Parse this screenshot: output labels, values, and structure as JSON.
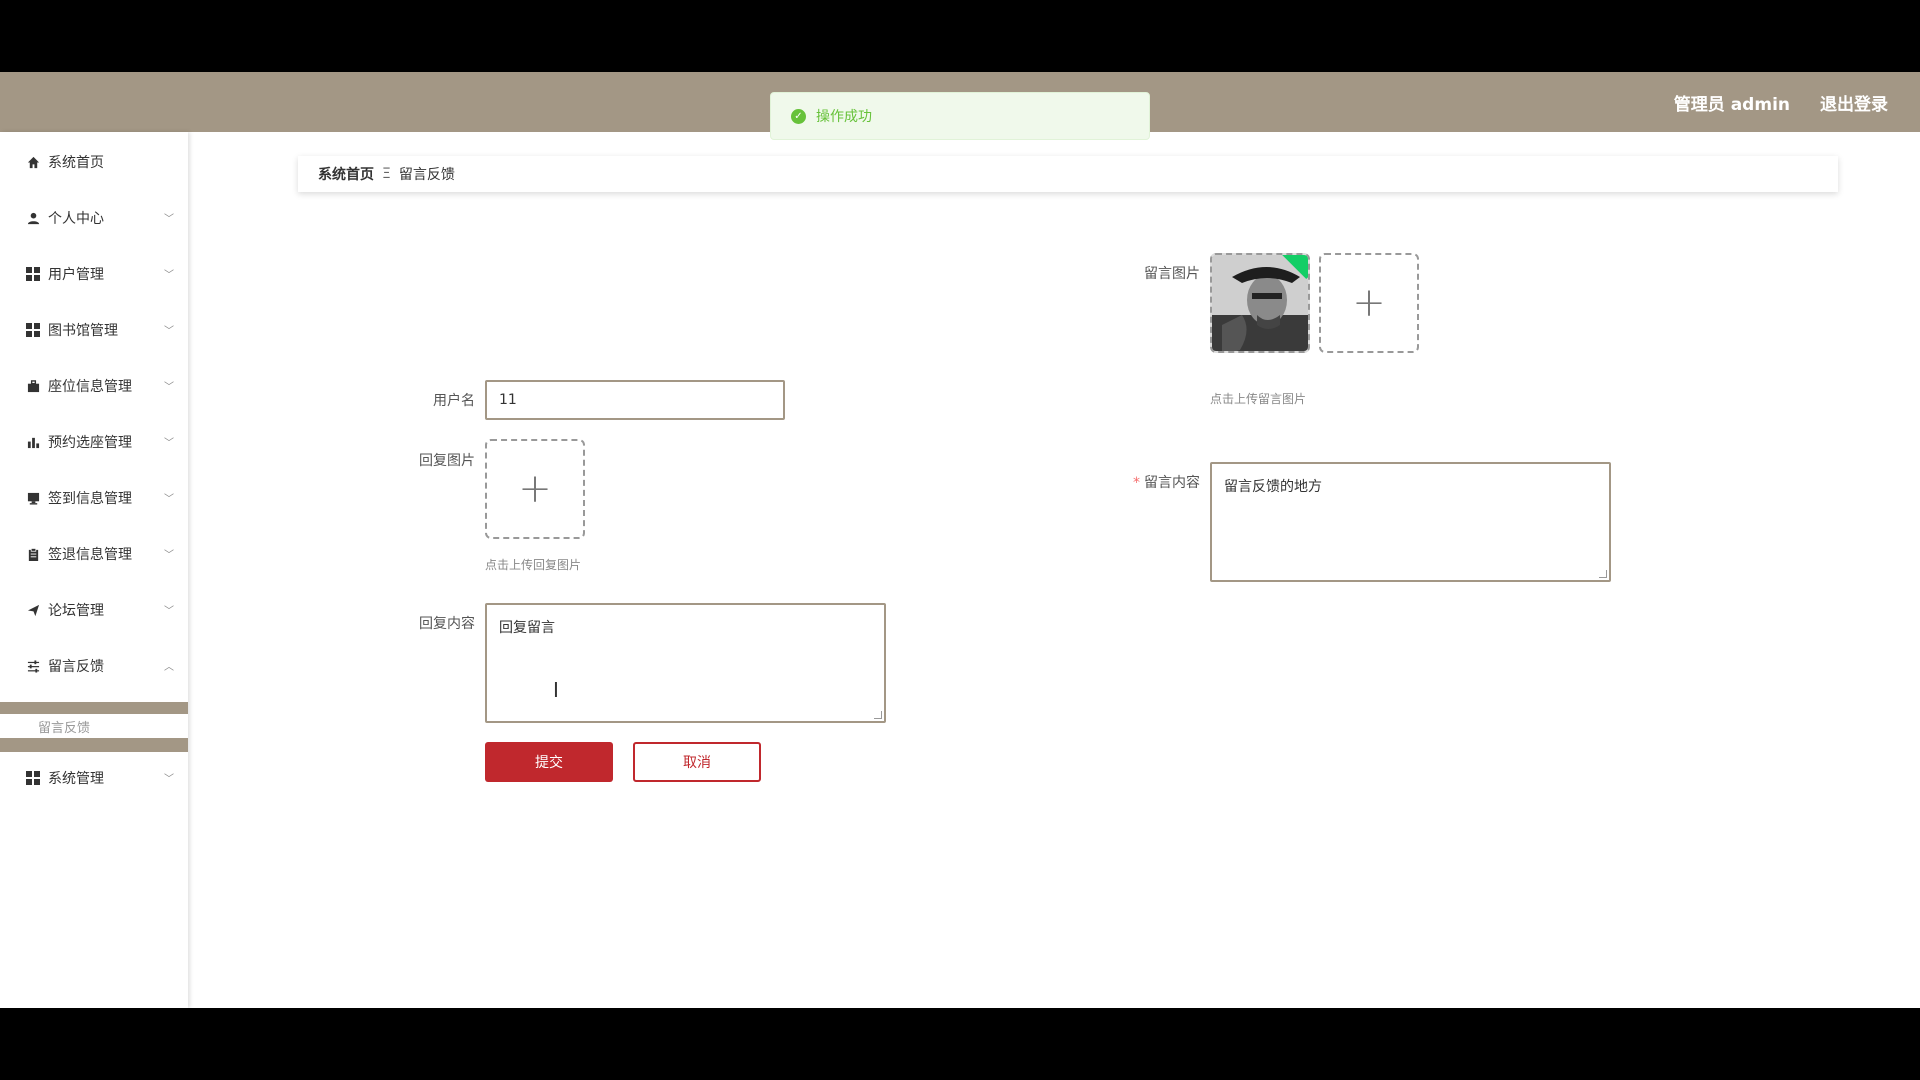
{
  "header": {
    "admin_label": "管理员 admin",
    "logout_label": "退出登录"
  },
  "toast": {
    "message": "操作成功",
    "icon": "check-circle-icon",
    "color": "#67c23a"
  },
  "sidebar": {
    "items": [
      {
        "label": "系统首页",
        "icon": "home-icon"
      },
      {
        "label": "个人中心",
        "icon": "user-icon"
      },
      {
        "label": "用户管理",
        "icon": "grid-icon"
      },
      {
        "label": "图书馆管理",
        "icon": "grid-icon"
      },
      {
        "label": "座位信息管理",
        "icon": "briefcase-icon"
      },
      {
        "label": "预约选座管理",
        "icon": "bar-chart-icon"
      },
      {
        "label": "签到信息管理",
        "icon": "monitor-icon"
      },
      {
        "label": "签退信息管理",
        "icon": "clipboard-icon"
      },
      {
        "label": "论坛管理",
        "icon": "send-icon"
      },
      {
        "label": "留言反馈",
        "icon": "sliders-icon"
      },
      {
        "label": "系统管理",
        "icon": "grid-icon"
      }
    ],
    "active_submenu": "留言反馈"
  },
  "breadcrumb": {
    "home": "系统首页",
    "separator": "Ξ",
    "current": "留言反馈"
  },
  "form": {
    "username_label": "用户名",
    "username_value": "11",
    "reply_image_label": "回复图片",
    "reply_image_hint": "点击上传回复图片",
    "reply_content_label": "回复内容",
    "reply_content_value": "回复留言",
    "message_image_label": "留言图片",
    "message_image_hint": "点击上传留言图片",
    "message_content_label": "留言内容",
    "message_content_value": "留言反馈的地方",
    "submit_label": "提交",
    "cancel_label": "取消"
  },
  "colors": {
    "accent": "#a39785",
    "primary_button": "#c0282d"
  }
}
